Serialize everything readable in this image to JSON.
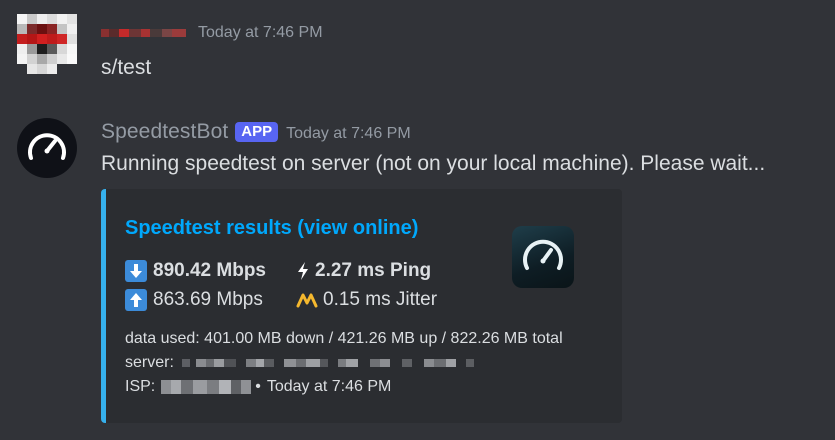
{
  "messages": [
    {
      "author": "",
      "timestamp": "Today at 7:46 PM",
      "text": "s/test"
    },
    {
      "author": "SpeedtestBot",
      "badge": "APP",
      "timestamp": "Today at 7:46 PM",
      "text": "Running speedtest on server (not on your local machine). Please wait..."
    }
  ],
  "embed": {
    "title": "Speedtest results (view online)",
    "accent_color": "#36b1ed",
    "download": "890.42 Mbps",
    "upload": "863.69 Mbps",
    "ping": "2.27 ms Ping",
    "jitter": "0.15 ms Jitter",
    "data_used": "data used: 401.00 MB down / 421.26 MB up / 822.26 MB total",
    "server_label": "server:",
    "isp_label": "ISP:",
    "isp_separator": "•",
    "footer_timestamp": "Today at 7:46 PM",
    "icons": {
      "download": "arrow-down-icon",
      "upload": "arrow-up-icon",
      "ping": "lightning-icon",
      "jitter": "jitter-icon",
      "thumbnail": "speedometer-icon"
    }
  },
  "colors": {
    "background": "#313338",
    "embed_background": "#2b2d31",
    "link": "#00a8fc",
    "badge": "#5865f2",
    "muted": "#949ba4",
    "text": "#dbdee1"
  }
}
